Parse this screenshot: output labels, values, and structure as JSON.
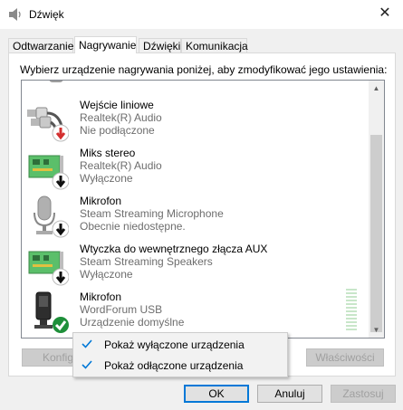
{
  "window": {
    "title": "Dźwięk",
    "close_glyph": "✕"
  },
  "tabs": [
    {
      "label": "Odtwarzanie"
    },
    {
      "label": "Nagrywanie"
    },
    {
      "label": "Dźwięki"
    },
    {
      "label": "Komunikacja"
    }
  ],
  "active_tab": "Nagrywanie",
  "instruction": "Wybierz urządzenie nagrywania poniżej, aby zmodyfikować jego ustawienia:",
  "devices": [
    {
      "name": "Wejście liniowe",
      "line2": "Realtek(R) Audio",
      "line3": "Nie podłączone",
      "icon": "line-in-jack-icon",
      "badge": "unplugged-badge",
      "badge_color": "#d32f2f"
    },
    {
      "name": "Miks stereo",
      "line2": "Realtek(R) Audio",
      "line3": "Wyłączone",
      "icon": "sound-card-icon",
      "badge": "disabled-badge",
      "badge_color": "#111111"
    },
    {
      "name": "Mikrofon",
      "line2": "Steam Streaming Microphone",
      "line3": "Obecnie niedostępne.",
      "icon": "microphone-icon",
      "badge": "disabled-badge",
      "badge_color": "#111111"
    },
    {
      "name": "Wtyczka do wewnętrznego złącza AUX",
      "line2": "Steam Streaming Speakers",
      "line3": "Wyłączone",
      "icon": "sound-card-icon",
      "badge": "disabled-badge",
      "badge_color": "#111111"
    },
    {
      "name": "Mikrofon",
      "line2": "WordForum USB",
      "line3": "Urządzenie domyślne",
      "icon": "microphone-icon",
      "badge": "default-check-badge",
      "badge_color": "#1e8f3a"
    }
  ],
  "level_meter_level": 0,
  "buttons": {
    "configure": "Konfig",
    "properties": "Właściwości",
    "ok": "OK",
    "cancel": "Anuluj",
    "apply": "Zastosuj"
  },
  "context_menu": [
    {
      "label": "Pokaż wyłączone urządzenia",
      "checked": true
    },
    {
      "label": "Pokaż odłączone urządzenia",
      "checked": true
    }
  ],
  "colors": {
    "accent": "#0078d7",
    "check": "#0078d7"
  }
}
